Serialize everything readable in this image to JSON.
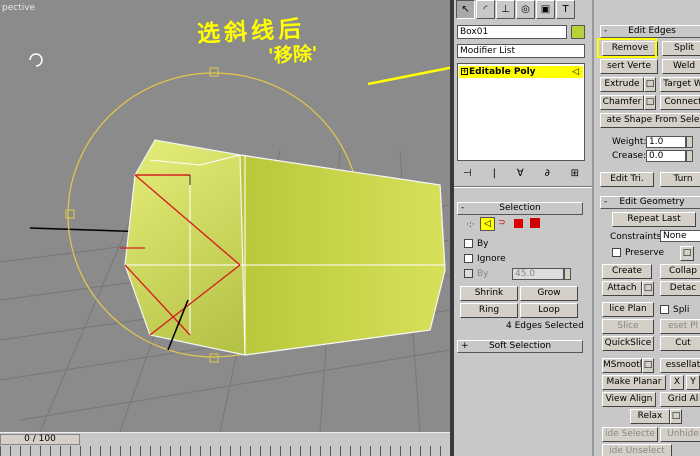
{
  "viewport": {
    "label": "pective",
    "annotation_line1": "选斜线后",
    "annotation_line2": "'移除'"
  },
  "timeline": {
    "frame_counter": "0 / 100"
  },
  "command_panel": {
    "tabs": [
      "arrow",
      "arc",
      "hier",
      "motion",
      "display",
      "T"
    ],
    "object_name": "Box01",
    "object_color": "#b5d23b",
    "modifier_list": "Modifier List",
    "stack_item": "Editable Poly",
    "stack_icon": "triangle-icon",
    "stack_tools": [
      "⊣",
      "|",
      "∀",
      "∂",
      "⊞"
    ],
    "selection": {
      "title": "Selection",
      "pm": "-",
      "by_vertex": "By",
      "ignore": "Ignore",
      "by_angle": "By",
      "angle_value": "45.0",
      "shrink": "Shrink",
      "grow": "Grow",
      "ring": "Ring",
      "loop": "Loop",
      "status": "4 Edges Selected"
    },
    "soft_selection": {
      "title": "Soft Selection",
      "pm": "+"
    }
  },
  "right_panel": {
    "edit_edges": {
      "title": "Edit Edges",
      "pm": "-",
      "remove": "Remove",
      "split": "Split",
      "insert_vertex": "sert Verte",
      "weld": "Weld",
      "extrude": "Extrude",
      "target_weld": "Target W",
      "chamfer": "Chamfer",
      "connect": "Connect",
      "create_shape": "ate Shape From Sele",
      "weight_label": "Weight:",
      "weight_value": "1.0",
      "crease_label": "Crease:",
      "crease_value": "0.0",
      "edit_tri": "Edit Tri.",
      "turn": "Turn"
    },
    "edit_geometry": {
      "title": "Edit Geometry",
      "pm": "-",
      "repeat_last": "Repeat Last",
      "constraints_label": "Constraints:",
      "constraints_value": "None",
      "preserve": "Preserve",
      "create": "Create",
      "collapse": "Collap",
      "attach": "Attach",
      "detach": "Detac",
      "slice_plane": "lice Plan",
      "split": "Spli",
      "slice": "Slice",
      "reset_plane": "eset Pl",
      "quickslice": "QuickSlice",
      "cut": "Cut",
      "msmooth": "MSmooth",
      "tessellate": "essellat",
      "make_planar": "Make Planar",
      "x": "X",
      "y": "Y",
      "view_align": "View Align",
      "grid_align": "Grid Al",
      "relax": "Relax",
      "hide_selected": "ide Selecte",
      "unhide": "Unhide",
      "hide_unselected": "ide Unselect"
    }
  }
}
